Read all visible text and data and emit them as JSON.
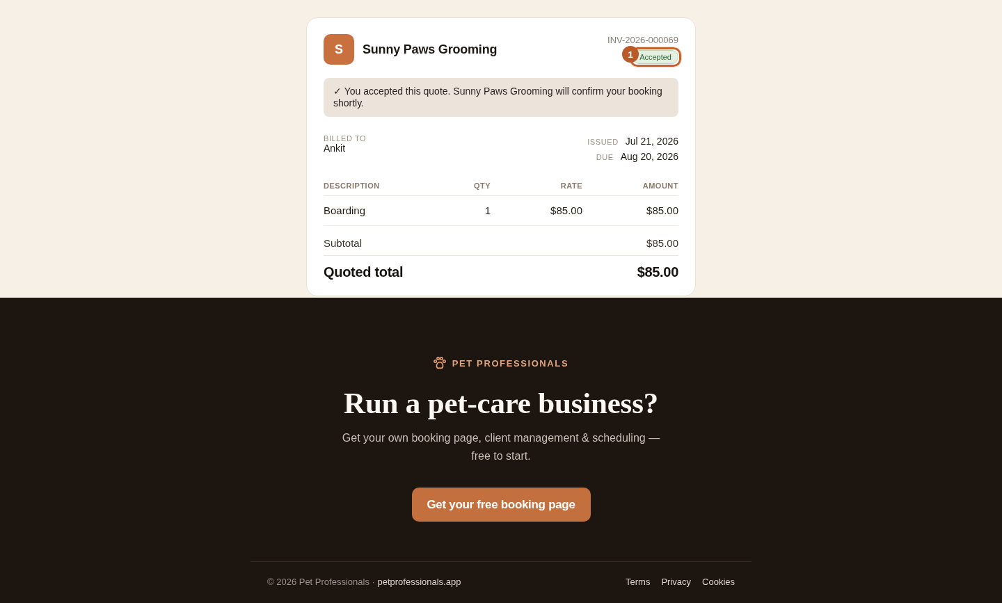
{
  "quote": {
    "business": {
      "initial": "S",
      "name": "Sunny Paws Grooming"
    },
    "number": "INV-2026-000069",
    "status": {
      "label": "Accepted",
      "kind": "accepted",
      "annotation": "1"
    },
    "notice": "✓ You accepted this quote. Sunny Paws Grooming will confirm your booking shortly.",
    "billed_to": {
      "label": "BILLED TO",
      "name": "Ankit"
    },
    "dates": [
      {
        "label": "ISSUED",
        "value": "Jul 21, 2026"
      },
      {
        "label": "DUE",
        "value": "Aug 20, 2026"
      }
    ],
    "table": {
      "columns": [
        "DESCRIPTION",
        "QTY",
        "RATE",
        "AMOUNT"
      ],
      "rows": [
        [
          "Boarding",
          "1",
          "$85.00",
          "$85.00"
        ]
      ]
    },
    "totals": [
      {
        "kind": "subtotal",
        "label": "Subtotal",
        "value": "$85.00"
      },
      {
        "kind": "total",
        "label": "Quoted total",
        "value": "$85.00"
      }
    ]
  },
  "promo": {
    "eyebrow": "PET PROFESSIONALS",
    "heading": "Run a pet-care business?",
    "text": "Get your own booking page, client management & scheduling — free to start.",
    "button": "Get your free booking page"
  },
  "footer": {
    "copyright": "© 2026 Pet Professionals ·",
    "site": "petprofessionals.app",
    "links": [
      "Terms",
      "Privacy",
      "Cookies"
    ]
  }
}
